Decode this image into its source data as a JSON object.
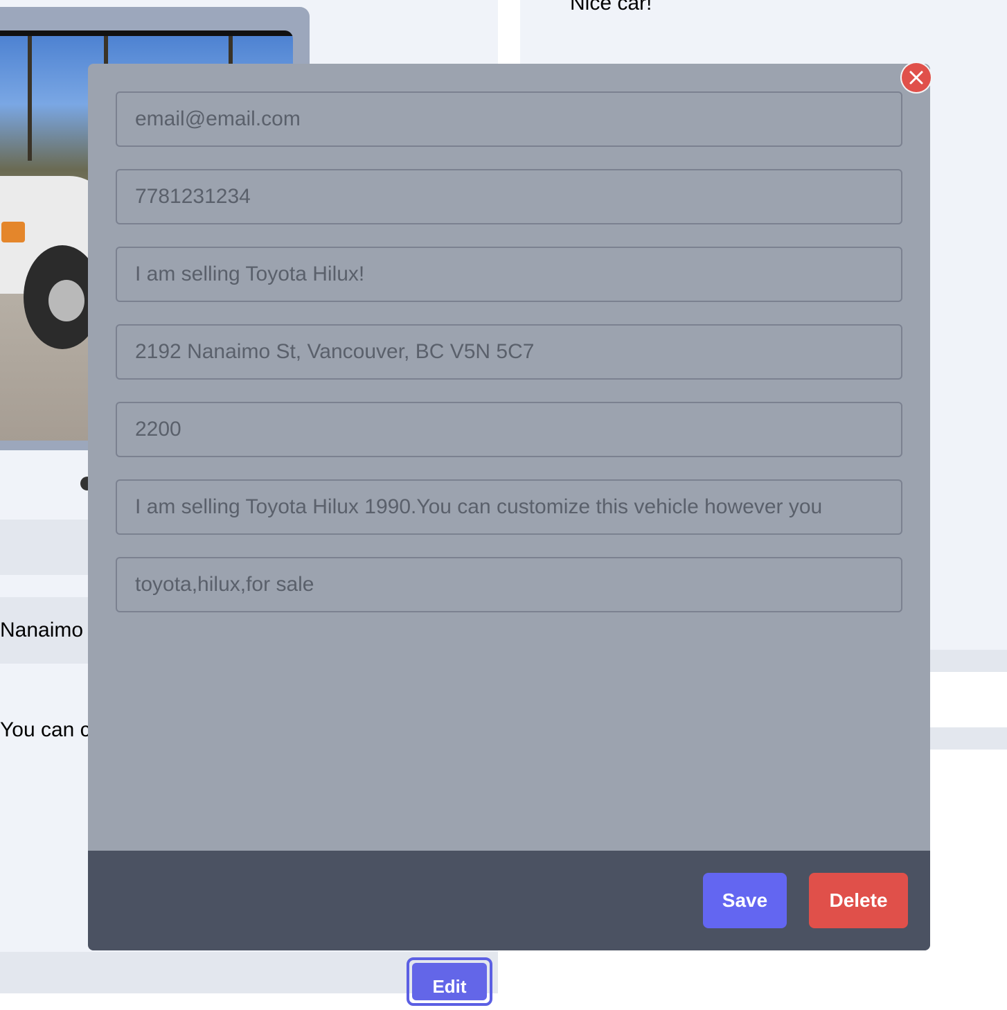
{
  "background": {
    "comment_text": "Nice car!",
    "address_fragment": "Nanaimo S",
    "description_fragment": "You can c",
    "edit_label": "Edit"
  },
  "modal": {
    "fields": {
      "email": "email@email.com",
      "phone": "7781231234",
      "title": "I am selling Toyota Hilux!",
      "address": "2192 Nanaimo St, Vancouver, BC V5N 5C7",
      "price": "2200",
      "description": "I am selling Toyota Hilux 1990.You can customize this vehicle however you",
      "tags": "toyota,hilux,for sale"
    },
    "save_label": "Save",
    "delete_label": "Delete",
    "close_icon": "close-icon"
  },
  "colors": {
    "modal_bg": "#9ca3af",
    "footer_bg": "#4b5262",
    "save": "#6366f1",
    "delete": "#e0504a"
  }
}
